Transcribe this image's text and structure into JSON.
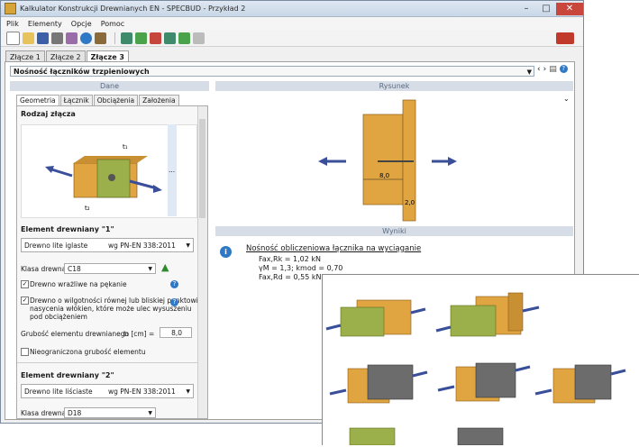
{
  "window": {
    "title": "Kalkulator Konstrukcji Drewnianych EN - SPECBUD - Przykład 2",
    "minimize": "–",
    "maximize": "□",
    "close": "✕"
  },
  "menu": {
    "items": [
      "Plik",
      "Elementy",
      "Opcje",
      "Pomoc"
    ]
  },
  "tabs": {
    "items": [
      "Złącze 1",
      "Złącze 2",
      "Złącze 3"
    ]
  },
  "header": {
    "combo_value": "Nośność łączników trzpieniowych"
  },
  "panels": {
    "data_label": "Dane",
    "drawing_label": "Rysunek",
    "results_label": "Wyniki"
  },
  "subtabs": {
    "items": [
      "Geometria",
      "Łącznik",
      "Obciążenia",
      "Założenia"
    ]
  },
  "geometry": {
    "joint_type_title": "Rodzaj złącza",
    "more": "...",
    "t1": "t₁",
    "t2": "t₂"
  },
  "element1": {
    "title": "Element drewniany \"1\"",
    "material": "Drewno lite iglaste",
    "standard": "wg PN-EN 338:2011",
    "class_label": "Klasa drewna",
    "class_value": "C18",
    "cb1": "Drewno wrażliwe na pękanie",
    "cb2_l1": "Drewno o wilgotności równej lub bliskiej punktowi",
    "cb2_l2": "nasycenia włókien, które może ulec wysuszeniu",
    "cb2_l3": "pod obciążeniem",
    "thickness_label": "Grubość elementu drewnianego",
    "thickness_sym": "t₁ [cm] =",
    "thickness_value": "8,0",
    "cb3": "Nieograniczona grubość elementu"
  },
  "element2": {
    "title": "Element drewniany \"2\"",
    "material": "Drewno lite liściaste",
    "standard": "wg PN-EN 338:2011",
    "class_label": "Klasa drewna",
    "class_value": "D18"
  },
  "drawing": {
    "dim1": "8,0",
    "dim2": "2,0"
  },
  "results": {
    "title": "Nośność obliczeniowa łącznika na wyciąganie",
    "line1": "Fax,Rk = 1,02 kN",
    "line2": "γM = 1,3;  kmod = 0,70",
    "line3": "Fax,Rd = 0,55 kN"
  },
  "colors": {
    "accent": "#2e78c6",
    "wood": "#e0a441",
    "wood_dark": "#b97d24",
    "green_wood": "#9bb04a",
    "arrow": "#3a4f9a",
    "steel": "#6c6c6c"
  }
}
